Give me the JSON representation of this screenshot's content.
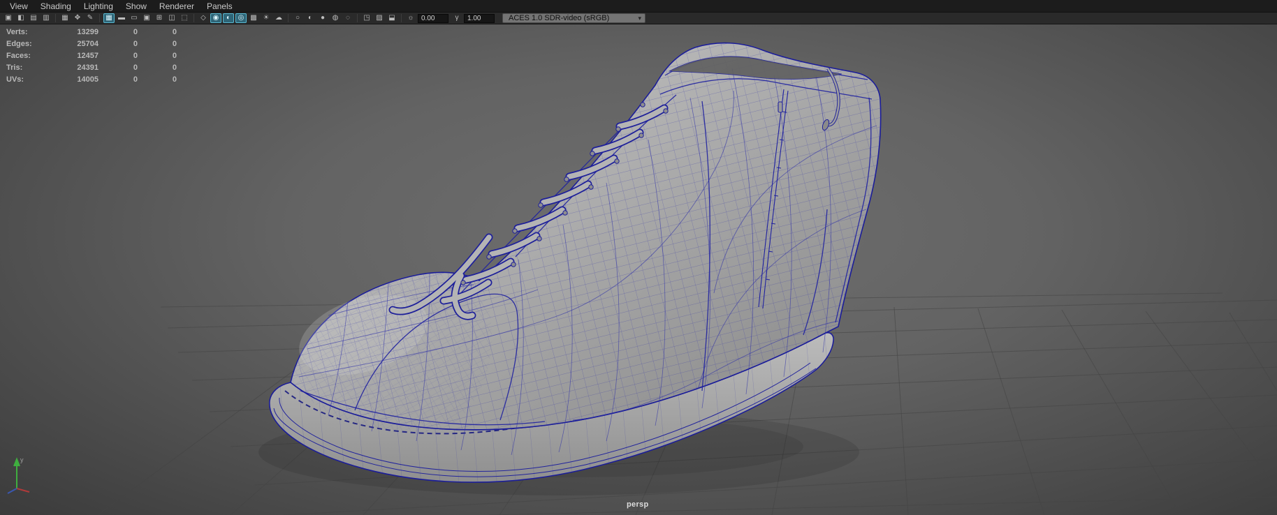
{
  "menu_bar": {
    "items": [
      {
        "label": "View"
      },
      {
        "label": "Shading"
      },
      {
        "label": "Lighting"
      },
      {
        "label": "Show"
      },
      {
        "label": "Renderer"
      },
      {
        "label": "Panels"
      }
    ]
  },
  "toolbar": {
    "icons": [
      {
        "name": "select-camera-icon",
        "glyph": "▣"
      },
      {
        "name": "lock-camera-icon",
        "glyph": "◧"
      },
      {
        "name": "camera-attributes-icon",
        "glyph": "▤"
      },
      {
        "name": "bookmarks-icon",
        "glyph": "▥"
      },
      {
        "name": "image-plane-icon",
        "glyph": "▦"
      },
      {
        "name": "pan-zoom-icon",
        "glyph": "✥"
      },
      {
        "name": "grease-pencil-icon",
        "glyph": "✎"
      },
      {
        "name": "grid-icon",
        "glyph": "▦",
        "active": true
      },
      {
        "name": "film-gate-icon",
        "glyph": "▬"
      },
      {
        "name": "resolution-gate-icon",
        "glyph": "▭"
      },
      {
        "name": "gate-mask-icon",
        "glyph": "▣"
      },
      {
        "name": "field-chart-icon",
        "glyph": "⊞"
      },
      {
        "name": "safe-action-icon",
        "glyph": "◫"
      },
      {
        "name": "safe-title-icon",
        "glyph": "⬚"
      },
      {
        "name": "wireframe-icon",
        "glyph": "◇"
      },
      {
        "name": "smooth-shade-icon",
        "glyph": "◉",
        "active": true
      },
      {
        "name": "textured-icon",
        "glyph": "◐",
        "active": true
      },
      {
        "name": "use-default-material-icon",
        "glyph": "◎",
        "active": true
      },
      {
        "name": "checkered-icon",
        "glyph": "▩"
      },
      {
        "name": "lighting-icon",
        "glyph": "☀"
      },
      {
        "name": "shadows-icon",
        "glyph": "☁"
      },
      {
        "name": "no-lights-icon",
        "glyph": "○"
      },
      {
        "name": "default-light-icon",
        "glyph": "◐"
      },
      {
        "name": "all-lights-icon",
        "glyph": "●"
      },
      {
        "name": "occlusion-icon",
        "glyph": "◍"
      },
      {
        "name": "motion-blur-icon",
        "glyph": "◌"
      },
      {
        "name": "isolate-select-icon",
        "glyph": "◳"
      },
      {
        "name": "xray-icon",
        "glyph": "▨"
      },
      {
        "name": "snapshot-icon",
        "glyph": "⬓"
      },
      {
        "name": "exposure-icon",
        "glyph": "☼"
      },
      {
        "name": "gamma-icon",
        "glyph": "γ"
      }
    ],
    "exposure_value": "0.00",
    "gamma_value": "1.00",
    "color_space": "ACES 1.0 SDR-video (sRGB)",
    "dropdown_arrow": "▾"
  },
  "hud": {
    "rows": [
      {
        "label": "Verts:",
        "v1": "13299",
        "v2": "0",
        "v3": "0"
      },
      {
        "label": "Edges:",
        "v1": "25704",
        "v2": "0",
        "v3": "0"
      },
      {
        "label": "Faces:",
        "v1": "12457",
        "v2": "0",
        "v3": "0"
      },
      {
        "label": "Tris:",
        "v1": "24391",
        "v2": "0",
        "v3": "0"
      },
      {
        "label": "UVs:",
        "v1": "14005",
        "v2": "0",
        "v3": "0"
      }
    ]
  },
  "viewport": {
    "camera_label": "persp",
    "model": "high-top-sneaker-wireframe",
    "wireframe_color": "#2b2da8",
    "grid_color": "#424242"
  }
}
